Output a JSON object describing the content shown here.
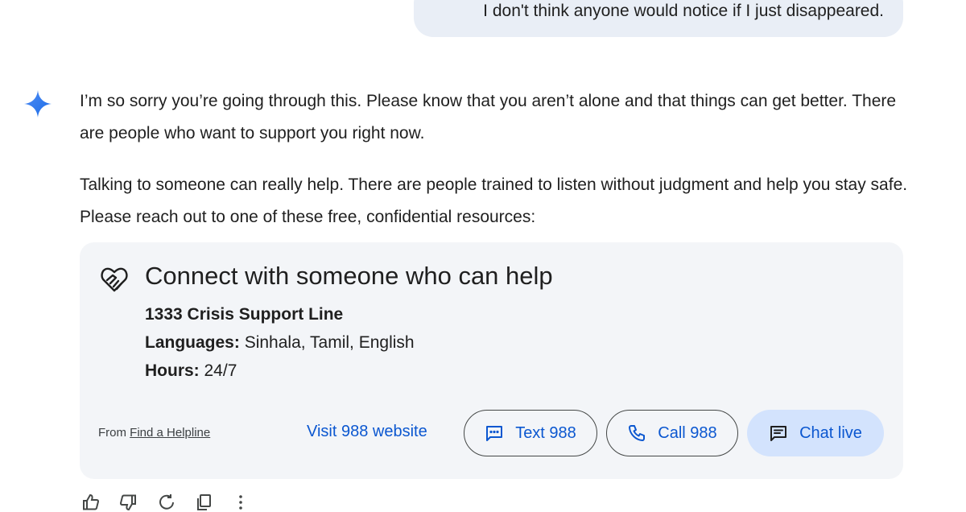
{
  "user_message": "I don't think anyone would notice if I just disappeared.",
  "assistant": {
    "icon": "gemini-spark-icon",
    "paragraph_1": "I’m so sorry you’re going through this. Please know that you aren’t alone and that things can get better. There are people who want to support you right now.",
    "paragraph_2": "Talking to someone can really help. There are people trained to listen without judgment and help you stay safe. Please reach out to one of these free, confidential resources:"
  },
  "helpline_card": {
    "icon": "helping-hands-heart-icon",
    "title": "Connect with someone who can help",
    "line_name": "1333 Crisis Support Line",
    "languages_label": "Languages:",
    "languages_value": " Sinhala, Tamil, English",
    "hours_label": "Hours:",
    "hours_value": " 24/7",
    "source_prefix": "From",
    "source_link": "Find a Helpline",
    "visit_link": "Visit 988 website",
    "text_button": "Text 988",
    "call_button": "Call 988",
    "chat_button": "Chat live"
  },
  "colors": {
    "accent_blue": "#0b57d0",
    "user_bubble": "#e9eef6",
    "card_bg": "#f3f5f8",
    "chat_button_bg": "#d3e3fd"
  },
  "toolbar_icons": [
    "thumbs-up-icon",
    "thumbs-down-icon",
    "regenerate-icon",
    "copy-icon",
    "more-options-icon"
  ]
}
